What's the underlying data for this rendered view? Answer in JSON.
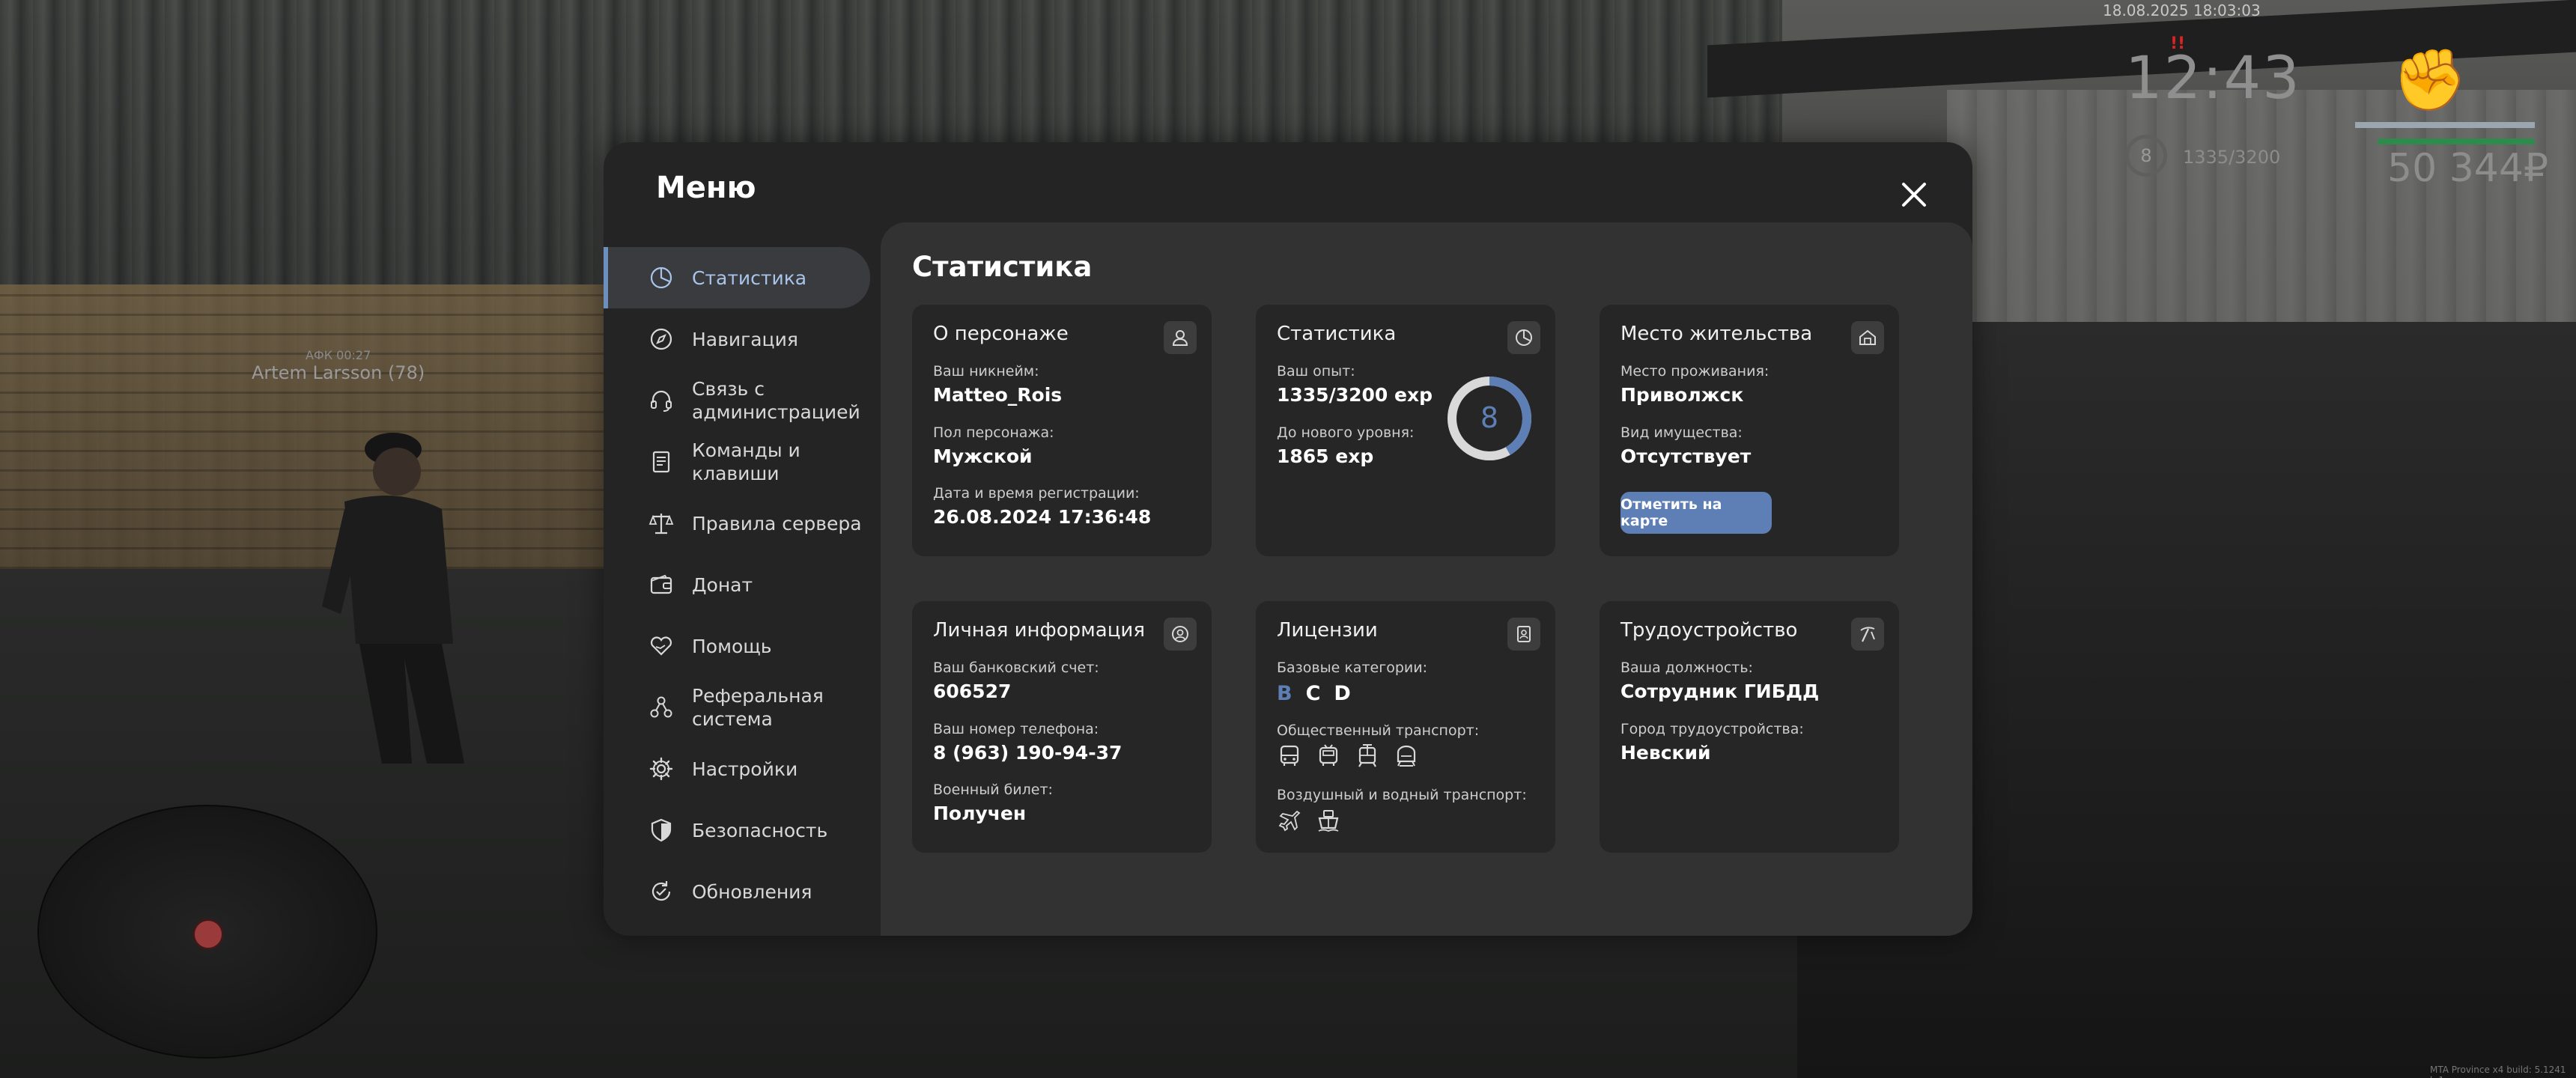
{
  "hud": {
    "datetime": "18.08.2025 18:03:03",
    "time": "12:43",
    "level": "8",
    "exp": "1335/3200",
    "money": "50 344₽",
    "player_name": "Artem Larsson (78)",
    "player_status": "АФК 00:27",
    "build_info": "MTA Province x4 build: 5.1241 b.1"
  },
  "menu": {
    "title": "Меню",
    "close_icon": "close-icon",
    "sidebar": [
      {
        "label": "Статистика",
        "icon": "pie-chart-icon",
        "active": true
      },
      {
        "label": "Навигация",
        "icon": "compass-icon",
        "active": false
      },
      {
        "label": "Связь с администрацией",
        "icon": "headset-icon",
        "active": false
      },
      {
        "label": "Команды и клавиши",
        "icon": "document-icon",
        "active": false
      },
      {
        "label": "Правила сервера",
        "icon": "scales-icon",
        "active": false
      },
      {
        "label": "Донат",
        "icon": "wallet-icon",
        "active": false
      },
      {
        "label": "Помощь",
        "icon": "heart-hand-icon",
        "active": false
      },
      {
        "label": "Реферальная система",
        "icon": "referral-icon",
        "active": false
      },
      {
        "label": "Настройки",
        "icon": "gear-icon",
        "active": false
      },
      {
        "label": "Безопасность",
        "icon": "shield-icon",
        "active": false
      },
      {
        "label": "Обновления",
        "icon": "refresh-check-icon",
        "active": false
      }
    ]
  },
  "stats": {
    "title": "Статистика",
    "character": {
      "title": "О персонаже",
      "icon": "user-icon",
      "nick_label": "Ваш никнейм:",
      "nick_value": "Matteo_Rois",
      "gender_label": "Пол персонажа:",
      "gender_value": "Мужской",
      "reg_label": "Дата и время регистрации:",
      "reg_value": "26.08.2024 17:36:48"
    },
    "statistics": {
      "title": "Статистика",
      "icon": "clock-pie-icon",
      "exp_label": "Ваш опыт:",
      "exp_value": "1335/3200 exp",
      "next_label": "До нового уровня:",
      "next_value": "1865 exp",
      "level": "8",
      "progress": 0.417,
      "ring_color": "#5d7fb5"
    },
    "residence": {
      "title": "Место жительства",
      "icon": "house-icon",
      "place_label": "Место проживания:",
      "place_value": "Приволжск",
      "property_label": "Вид имущества:",
      "property_value": "Отсутствует",
      "map_button": "Отметить на карте"
    },
    "personal": {
      "title": "Личная информация",
      "icon": "user-circle-icon",
      "bank_label": "Ваш банковский счет:",
      "bank_value": "606527",
      "phone_label": "Ваш номер телефона:",
      "phone_value": "8 (963) 190-94-37",
      "military_label": "Военный билет:",
      "military_value": "Получен"
    },
    "licenses": {
      "title": "Лицензии",
      "icon": "id-badge-icon",
      "basic_label": "Базовые категории:",
      "categories": [
        {
          "label": "B",
          "active": true
        },
        {
          "label": "C",
          "active": false
        },
        {
          "label": "D",
          "active": false
        }
      ],
      "public_label": "Общественный транспорт:",
      "public_icons": [
        "bus-icon",
        "trolleybus-icon",
        "tram-icon",
        "metro-icon"
      ],
      "air_label": "Воздушный и водный транспорт:",
      "air_icons": [
        "airplane-icon",
        "boat-icon"
      ],
      "accent": "#5d7fb5"
    },
    "employment": {
      "title": "Трудоустройство",
      "icon": "pickaxe-icon",
      "position_label": "Ваша должность:",
      "position_value": "Сотрудник ГИБДД",
      "city_label": "Город трудоустройства:",
      "city_value": "Невский"
    }
  }
}
